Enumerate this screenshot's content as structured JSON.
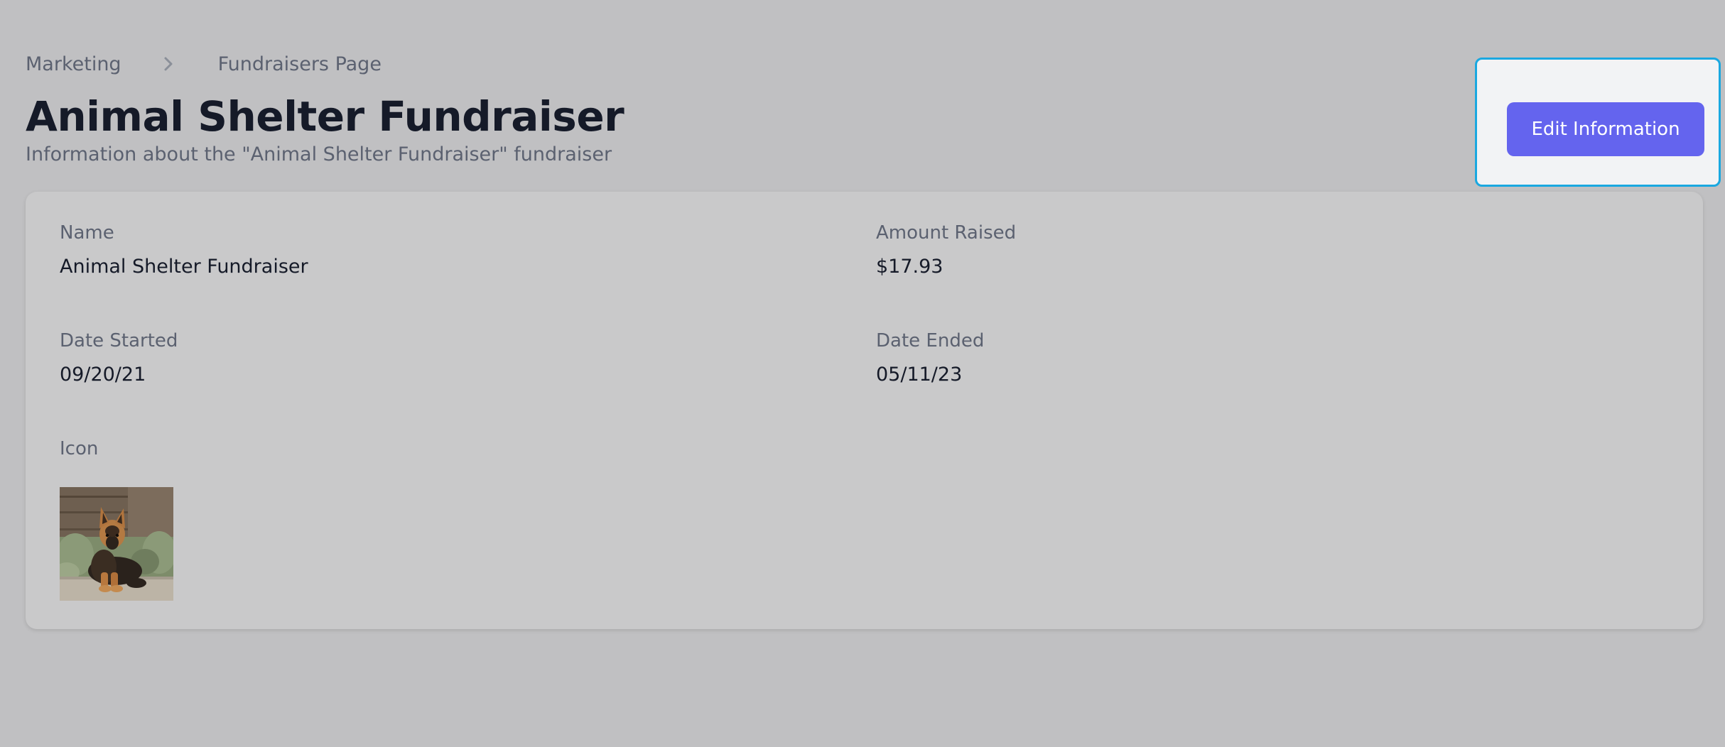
{
  "breadcrumb": {
    "items": [
      "Marketing",
      "Fundraisers Page"
    ],
    "separator_icon": "chevron-right-icon"
  },
  "header": {
    "title": "Animal Shelter Fundraiser",
    "subtitle": "Information about the \"Animal Shelter Fundraiser\" fundraiser",
    "edit_label": "Edit Information"
  },
  "details": {
    "name_label": "Name",
    "name_value": "Animal Shelter Fundraiser",
    "amount_label": "Amount Raised",
    "amount_value": "$17.93",
    "date_started_label": "Date Started",
    "date_started_value": "09/20/21",
    "date_ended_label": "Date Ended",
    "date_ended_value": "05/11/23",
    "icon_label": "Icon",
    "icon_image": "german-shepherd-puppy-photo"
  },
  "colors": {
    "background": "#c0c0c2",
    "card": "#c9c9ca",
    "accent_button": "#6464ee",
    "focus_outline": "#1aa8e0",
    "title_text": "#151a28",
    "muted_text": "#5b6170"
  }
}
